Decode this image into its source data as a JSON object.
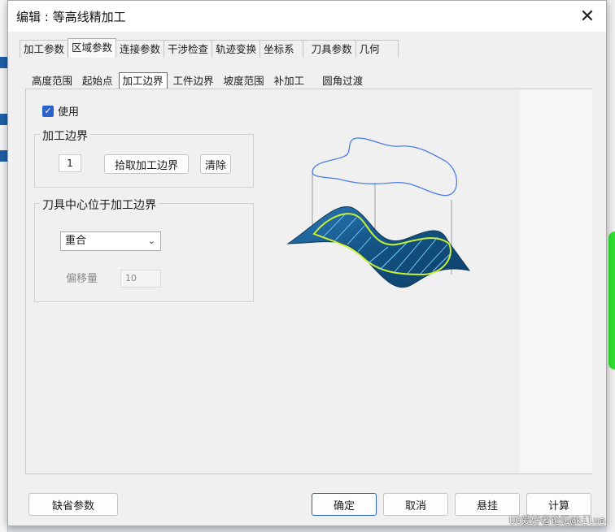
{
  "dialog": {
    "title": "编辑 : 等高线精加工",
    "close_glyph": "✕"
  },
  "tabs": [
    "加工参数",
    "区域参数",
    "连接参数",
    "干涉检查",
    "轨迹变换",
    "坐标系",
    "刀具参数",
    "几何"
  ],
  "active_tab": 1,
  "subtabs": [
    "高度范围",
    "起始点",
    "加工边界",
    "工件边界",
    "坡度范围",
    "补加工",
    "圆角过渡"
  ],
  "active_subtab": 2,
  "use_checkbox": {
    "label": "使用",
    "checked": true,
    "check_glyph": "✓"
  },
  "boundary_group": {
    "title": "加工边界",
    "count": "1",
    "pick_button": "拾取加工边界",
    "clear_button": "清除"
  },
  "tool_center_group": {
    "title": "刀具中心位于加工边界",
    "select_value": "重合",
    "chevron_glyph": "⌄",
    "offset_label": "偏移量",
    "offset_value": "10"
  },
  "buttons": {
    "defaults": "缺省参数",
    "ok": "确定",
    "cancel": "取消",
    "suspend": "悬挂",
    "calculate": "计算"
  },
  "watermark": "UG爱好者论坛@kilua",
  "colors": {
    "accent": "#2a62c9",
    "surface": "#1a5e92",
    "boundary": "#c8f230",
    "hatch": "#7fd8ff",
    "curve": "#4a7ee0"
  }
}
